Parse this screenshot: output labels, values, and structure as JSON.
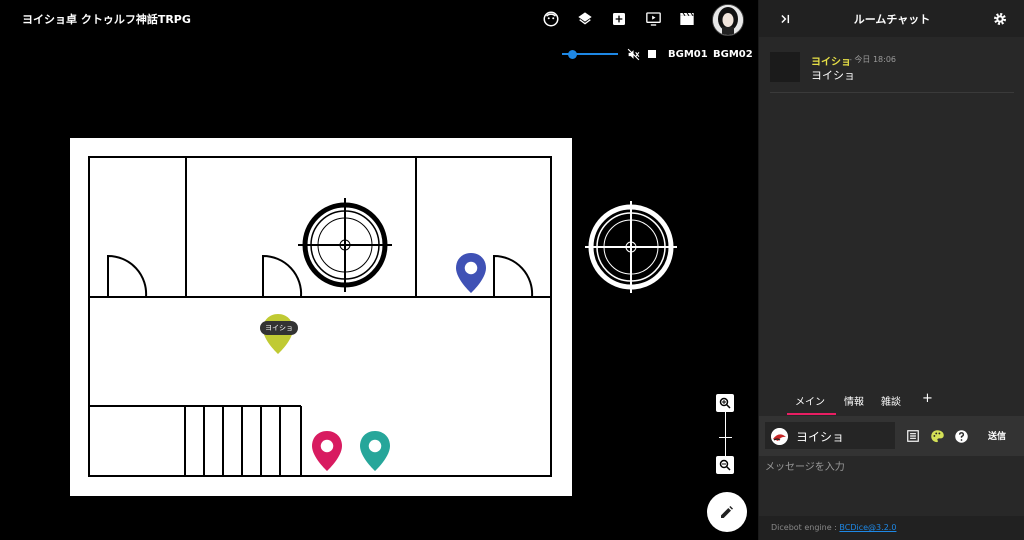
{
  "room": {
    "title": "ヨイショ卓 クトゥルフ神話TRPG"
  },
  "toolbar": {
    "icons": [
      "face-icon",
      "layers-icon",
      "add-box-icon",
      "screen-icon",
      "clapper-icon"
    ],
    "bgm": {
      "volume": 0.2,
      "muted": true,
      "tracks": [
        "BGM01",
        "BGM02"
      ]
    }
  },
  "map": {
    "token_label": "ヨイショ",
    "pin_colors": {
      "blue": "#3f51b5",
      "yellow": "#c0ca33",
      "pink": "#d81b60",
      "teal": "#26a69a"
    }
  },
  "chat": {
    "title": "ルームチャット",
    "messages": [
      {
        "name": "ヨイショ",
        "time": "- 今日 18:06",
        "text": "ヨイショ"
      }
    ],
    "tabs": [
      "メイン",
      "情報",
      "雑談",
      "+"
    ],
    "composer": {
      "character": "ヨイショ",
      "send_label": "送信",
      "placeholder": "メッセージを入力"
    },
    "footer": {
      "prefix": "Dicebot engine : ",
      "link": "BCDice@3.2.0"
    }
  },
  "colors": {
    "accent": "#e91e63",
    "name": "#e7e046",
    "link": "#1e88e5"
  }
}
